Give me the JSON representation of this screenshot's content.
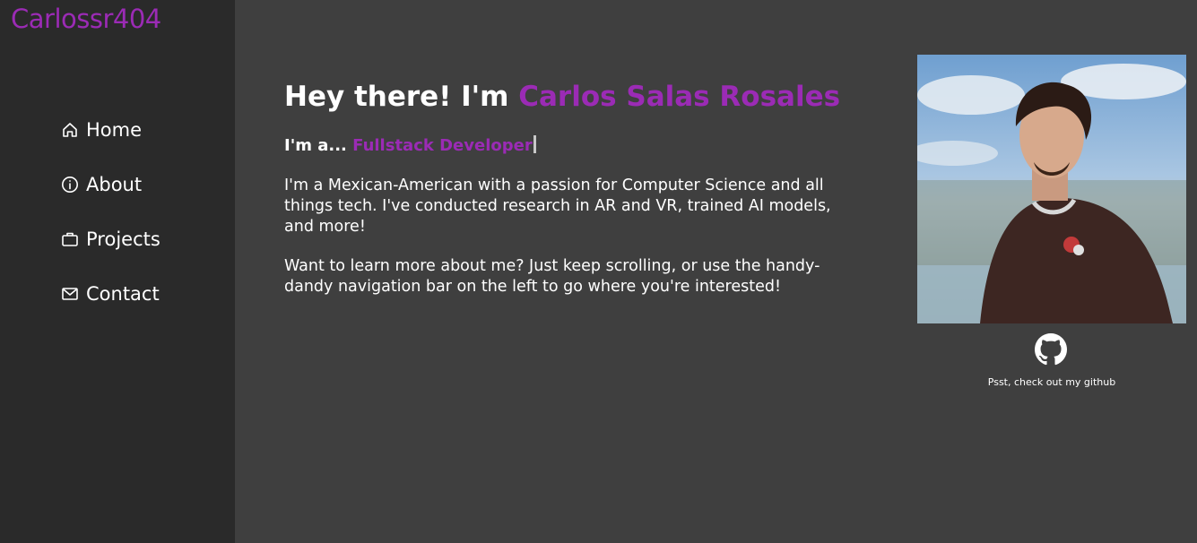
{
  "brand": "Carlossr404",
  "nav": {
    "items": [
      {
        "label": "Home",
        "icon": "home-icon"
      },
      {
        "label": "About",
        "icon": "info-icon"
      },
      {
        "label": "Projects",
        "icon": "briefcase-icon"
      },
      {
        "label": "Contact",
        "icon": "mail-icon"
      }
    ]
  },
  "hero": {
    "greeting": "Hey there! I'm",
    "name": "Carlos Salas Rosales",
    "role_prefix": "I'm a...",
    "role": "Fullstack Developer",
    "paragraph1": "I'm a Mexican-American with a passion for Computer Science and all things tech. I've conducted research in AR and VR, trained AI models, and more!",
    "paragraph2": "Want to learn more about me? Just keep scrolling, or use the handy-dandy navigation bar on the left to go where you're interested!"
  },
  "profile": {
    "github_icon": "github-icon",
    "github_caption": "Psst, check out my github"
  },
  "colors": {
    "accent": "#9b2bb5",
    "sidebar_bg": "#2a2a2a",
    "page_bg": "#3f3f3f",
    "text": "#ffffff"
  }
}
